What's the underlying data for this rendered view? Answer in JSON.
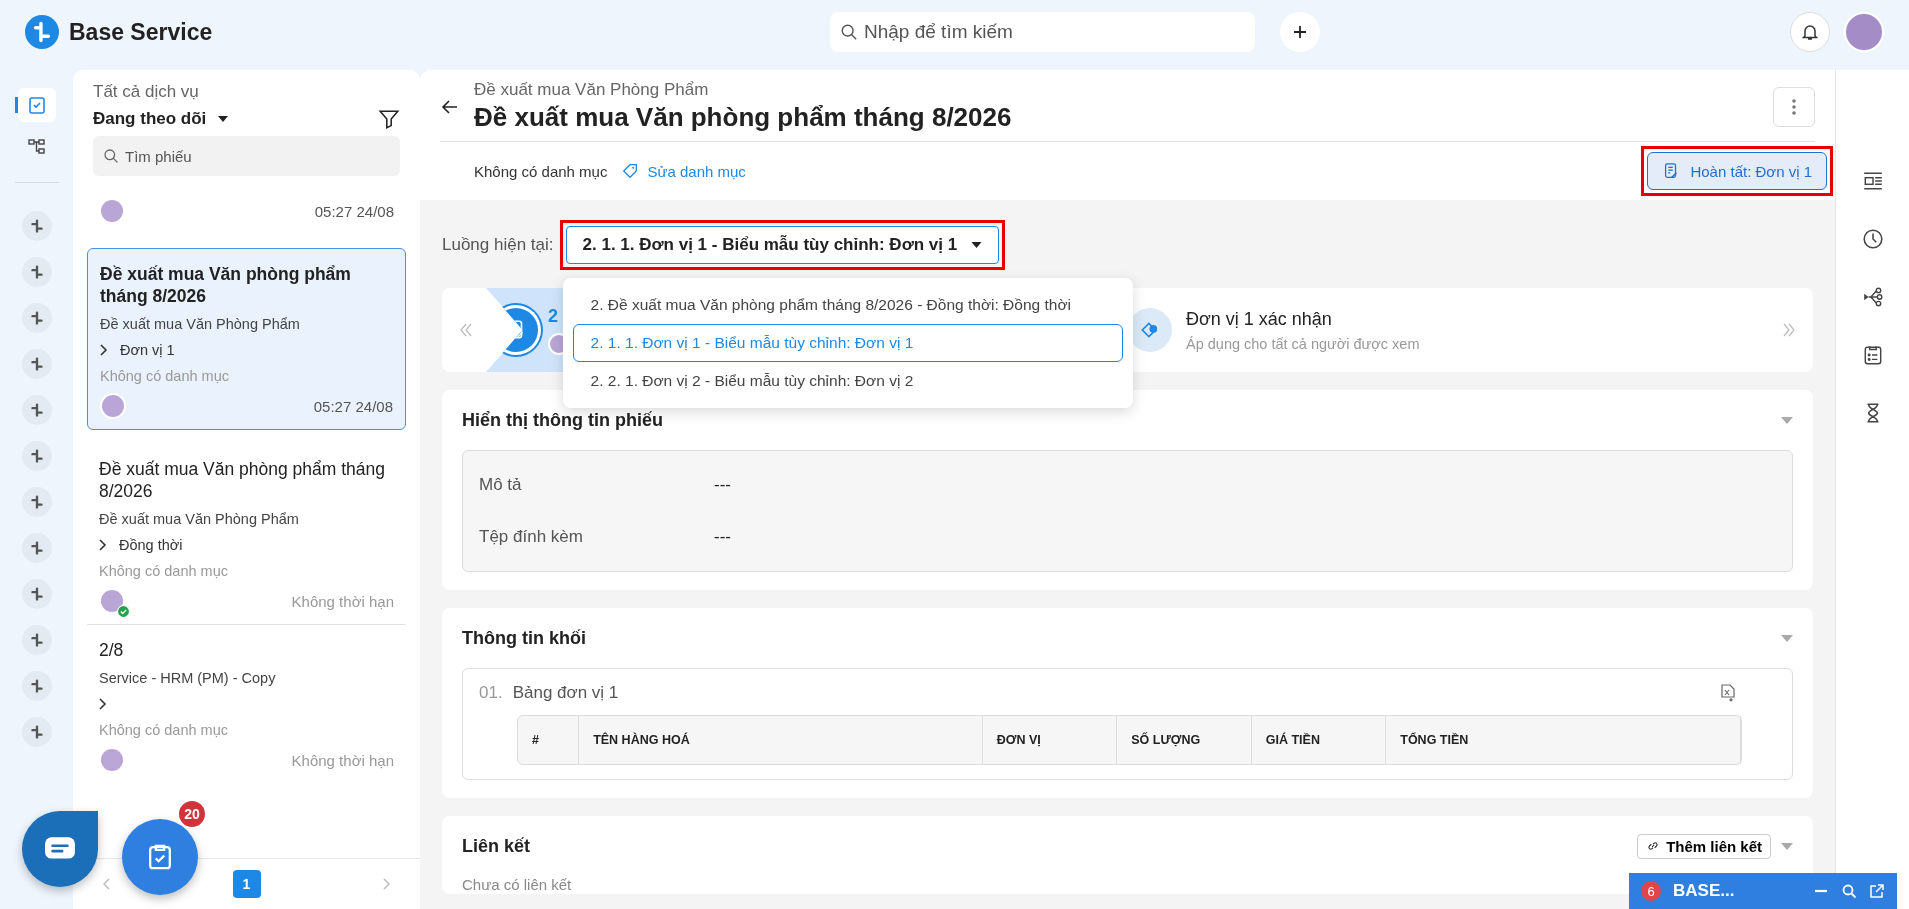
{
  "app": {
    "name": "Base Service"
  },
  "search": {
    "placeholder": "Nhập để tìm kiếm"
  },
  "list_panel": {
    "scope": "Tất cả dịch vụ",
    "filter": "Đang theo dõi",
    "search_placeholder": "Tìm phiếu",
    "items": [
      {
        "time": "05:27 24/08",
        "selected": false,
        "done": false
      },
      {
        "title": "Đề xuất mua Văn phòng phẩm tháng 8/2026",
        "service": "Đề xuất mua Văn Phòng Phẩm",
        "flow": "Đơn vị 1",
        "category": "Không có danh mục",
        "time": "05:27 24/08",
        "selected": true,
        "done": false
      },
      {
        "title": "Đề xuất mua Văn phòng phẩm tháng 8/2026",
        "service": "Đề xuất mua Văn Phòng Phẩm",
        "flow": "Đồng thời",
        "category": "Không có danh mục",
        "time": "Không thời hạn",
        "selected": false,
        "done": true
      },
      {
        "title": "2/8",
        "service": "Service - HRM (PM) - Copy",
        "category": "Không có danh mục",
        "time": "Không thời hạn",
        "selected": false,
        "done": false
      }
    ],
    "pages": [
      {
        "label": "1",
        "selected": true
      }
    ]
  },
  "badge": "20",
  "ticket": {
    "breadcrumb": "Đề xuất mua Văn Phòng Phẩm",
    "title": "Đề xuất mua Văn phòng phẩm tháng 8/2026",
    "category": "Không có danh mục",
    "edit_category": "Sửa danh mục",
    "action": {
      "label": "Hoàn tất: Đơn vị 1",
      "highlighted": true
    }
  },
  "flow": {
    "label": "Luồng hiện tại:",
    "value": "2. 1. 1. Đơn vị 1 - Biểu mẫu tùy chỉnh: Đơn vị 1",
    "highlighted": true,
    "options": [
      {
        "label": "2. Đề xuất mua Văn phòng phẩm tháng 8/2026 - Đồng thời: Đồng thời",
        "selected": false
      },
      {
        "label": "2. 1. 1. Đơn vị 1 - Biểu mẫu tùy chỉnh: Đơn vị 1",
        "selected": true
      },
      {
        "label": "2. 2. 1. Đơn vị 2 - Biểu mẫu tùy chỉnh: Đơn vị 2",
        "selected": false
      }
    ]
  },
  "steps": [
    {
      "title": "2",
      "selected": true
    },
    {
      "title": "Đơn vị 1 xác nhận",
      "subtitle": "Áp dụng cho tất cả người được xem",
      "selected": false
    }
  ],
  "info_section": {
    "title": "Hiển thị thông tin phiếu",
    "fields": [
      {
        "label": "Mô tả",
        "value": "---"
      },
      {
        "label": "Tệp đính kèm",
        "value": "---"
      }
    ]
  },
  "block_section": {
    "title": "Thông tin khối",
    "table_index": "01.",
    "table_title": "Bảng đơn vị 1",
    "columns": [
      "#",
      "TÊN HÀNG HOÁ",
      "ĐƠN VỊ",
      "SỐ LƯỢNG",
      "GIÁ TIỀN",
      "TỔNG TIỀN"
    ]
  },
  "link_section": {
    "title": "Liên kết",
    "add_button": "Thêm liên kết",
    "empty": "Chưa có liên kết"
  },
  "chat_widget": {
    "count": "6",
    "title": "BASE..."
  }
}
